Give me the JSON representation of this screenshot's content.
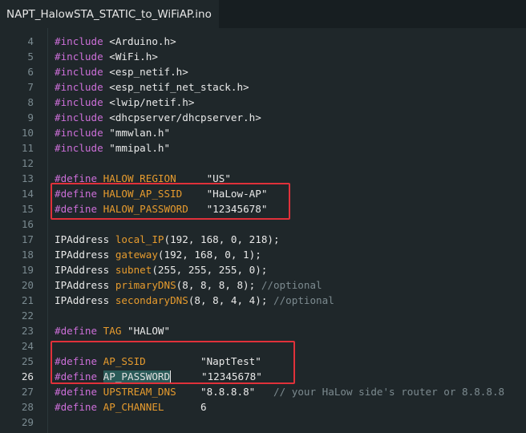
{
  "tab": {
    "title": "NAPT_HalowSTA_STATIC_to_WiFiAP.ino"
  },
  "lines": [
    {
      "n": "4",
      "tokens": [
        [
          "pp",
          "#include "
        ],
        [
          "str",
          "<Arduino.h>"
        ]
      ]
    },
    {
      "n": "5",
      "tokens": [
        [
          "pp",
          "#include "
        ],
        [
          "str",
          "<WiFi.h>"
        ]
      ]
    },
    {
      "n": "6",
      "tokens": [
        [
          "pp",
          "#include "
        ],
        [
          "str",
          "<esp_netif.h>"
        ]
      ]
    },
    {
      "n": "7",
      "tokens": [
        [
          "pp",
          "#include "
        ],
        [
          "str",
          "<esp_netif_net_stack.h>"
        ]
      ]
    },
    {
      "n": "8",
      "tokens": [
        [
          "pp",
          "#include "
        ],
        [
          "str",
          "<lwip/netif.h>"
        ]
      ]
    },
    {
      "n": "9",
      "tokens": [
        [
          "pp",
          "#include "
        ],
        [
          "str",
          "<dhcpserver/dhcpserver.h>"
        ]
      ]
    },
    {
      "n": "10",
      "tokens": [
        [
          "pp",
          "#include "
        ],
        [
          "str",
          "\"mmwlan.h\""
        ]
      ]
    },
    {
      "n": "11",
      "tokens": [
        [
          "pp",
          "#include "
        ],
        [
          "str",
          "\"mmipal.h\""
        ]
      ]
    },
    {
      "n": "12",
      "tokens": []
    },
    {
      "n": "13",
      "tokens": [
        [
          "pp",
          "#define "
        ],
        [
          "kw",
          "HALOW_REGION"
        ],
        [
          "str",
          "     \"US\""
        ]
      ]
    },
    {
      "n": "14",
      "tokens": [
        [
          "pp",
          "#define "
        ],
        [
          "kw",
          "HALOW_AP_SSID"
        ],
        [
          "str",
          "    \"HaLow-AP\""
        ]
      ]
    },
    {
      "n": "15",
      "tokens": [
        [
          "pp",
          "#define "
        ],
        [
          "kw",
          "HALOW_PASSWORD"
        ],
        [
          "str",
          "   \"12345678\""
        ]
      ]
    },
    {
      "n": "16",
      "tokens": []
    },
    {
      "n": "17",
      "tokens": [
        [
          "str",
          "IPAddress "
        ],
        [
          "kw",
          "local_IP"
        ],
        [
          "str",
          "(192, 168, 0, 218);"
        ]
      ]
    },
    {
      "n": "18",
      "tokens": [
        [
          "str",
          "IPAddress "
        ],
        [
          "kw",
          "gateway"
        ],
        [
          "str",
          "(192, 168, 0, 1);"
        ]
      ]
    },
    {
      "n": "19",
      "tokens": [
        [
          "str",
          "IPAddress "
        ],
        [
          "kw",
          "subnet"
        ],
        [
          "str",
          "(255, 255, 255, 0);"
        ]
      ]
    },
    {
      "n": "20",
      "tokens": [
        [
          "str",
          "IPAddress "
        ],
        [
          "kw",
          "primaryDNS"
        ],
        [
          "str",
          "(8, 8, 8, 8); "
        ],
        [
          "cm",
          "//optional"
        ]
      ]
    },
    {
      "n": "21",
      "tokens": [
        [
          "str",
          "IPAddress "
        ],
        [
          "kw",
          "secondaryDNS"
        ],
        [
          "str",
          "(8, 8, 4, 4); "
        ],
        [
          "cm",
          "//optional"
        ]
      ]
    },
    {
      "n": "22",
      "tokens": []
    },
    {
      "n": "23",
      "tokens": [
        [
          "pp",
          "#define "
        ],
        [
          "kw",
          "TAG"
        ],
        [
          "str",
          " \"HALOW\""
        ]
      ]
    },
    {
      "n": "24",
      "tokens": []
    },
    {
      "n": "25",
      "tokens": [
        [
          "pp",
          "#define "
        ],
        [
          "kw",
          "AP_SSID"
        ],
        [
          "str",
          "         \"NaptTest\""
        ]
      ]
    },
    {
      "n": "26",
      "tokens": [
        [
          "pp",
          "#define "
        ],
        [
          "sel",
          "AP_PASSWORD"
        ],
        [
          "str",
          "     \"12345678\""
        ]
      ]
    },
    {
      "n": "27",
      "tokens": [
        [
          "pp",
          "#define "
        ],
        [
          "kw",
          "UPSTREAM_DNS"
        ],
        [
          "str",
          "    \"8.8.8.8\"   "
        ],
        [
          "cm",
          "// your HaLow side's router or 8.8.8.8"
        ]
      ]
    },
    {
      "n": "28",
      "tokens": [
        [
          "pp",
          "#define "
        ],
        [
          "kw",
          "AP_CHANNEL"
        ],
        [
          "str",
          "      6"
        ]
      ]
    },
    {
      "n": "29",
      "tokens": []
    }
  ],
  "active_line": "26",
  "highlight_color": "#e0313a"
}
